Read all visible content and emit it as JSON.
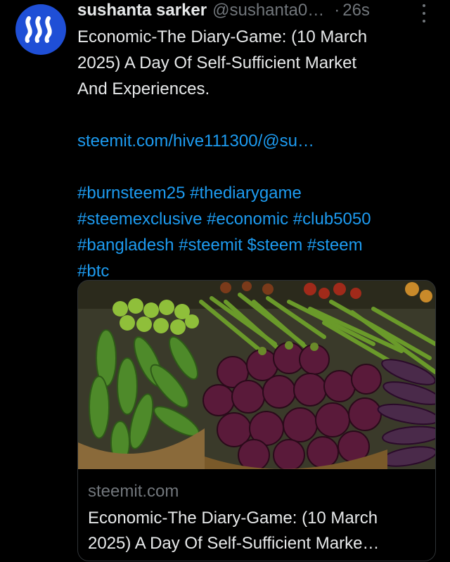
{
  "author": {
    "name": "sushanta sarker",
    "handle": "@sushanta0…",
    "separator": "·",
    "time": "26s"
  },
  "post": {
    "title_lines": [
      "Economic-The Diary-Game: (10 March",
      "2025) A Day Of Self-Sufficient Market",
      "And Experiences."
    ],
    "link": "steemit.com/hive111300/@su…",
    "hashtag_lines": [
      "#burnsteem25 #thediarygame",
      "#steemexclusive #economic #club5050",
      "#bangladesh #steemit $steem #steem",
      "#btc"
    ]
  },
  "card": {
    "domain": "steemit.com",
    "title_lines": [
      "Economic-The Diary-Game: (10 March",
      "2025) A Day Of Self-Sufficient Marke…"
    ]
  },
  "icons": {
    "avatar": "steem-logo-icon",
    "more": "more-options-icon"
  },
  "colors": {
    "background": "#000000",
    "text": "#e7e9ea",
    "muted": "#71767b",
    "link": "#1d9bf0",
    "avatar": "#1f4fd6"
  }
}
